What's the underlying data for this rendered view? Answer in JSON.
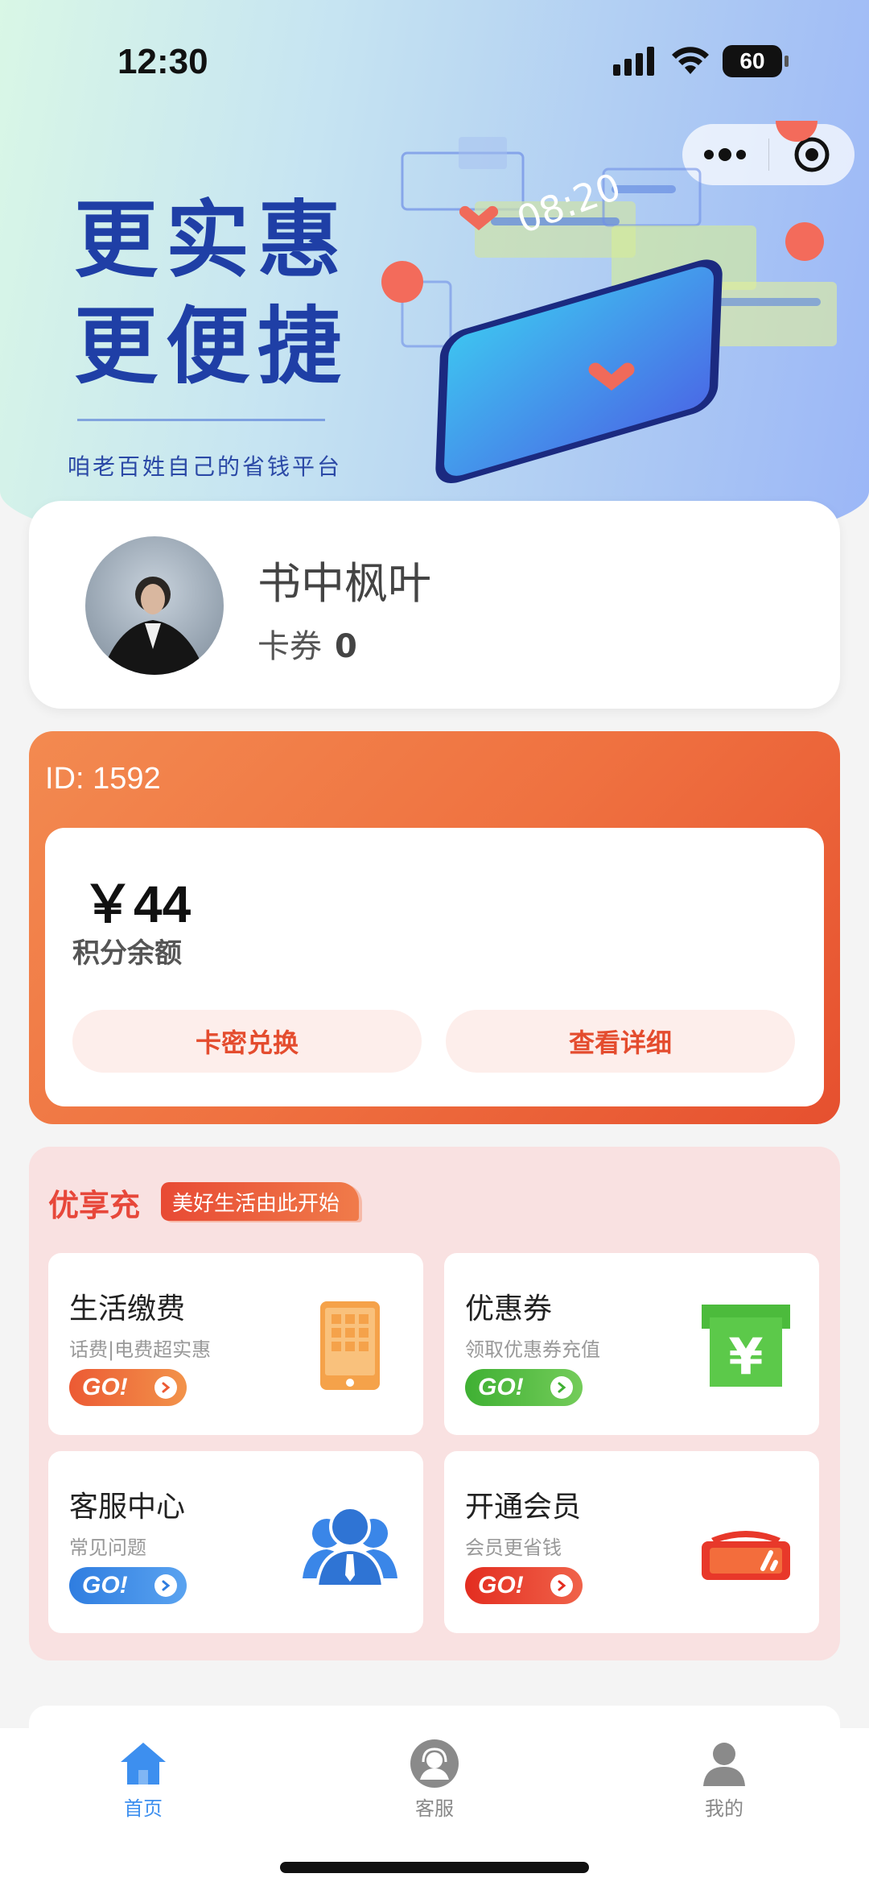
{
  "status_bar": {
    "time": "12:30",
    "battery": "60"
  },
  "banner": {
    "slogan_line1": "更实惠",
    "slogan_line2": "更便捷",
    "sub_slogan": "咱老百姓自己的省钱平台",
    "phone_time": "08:20"
  },
  "profile": {
    "nickname": "书中枫叶",
    "coupon_label": "卡券",
    "coupon_count": "0"
  },
  "points": {
    "id_label": "ID: 1592",
    "amount": "￥44",
    "amount_label": "积分余额",
    "redeem_button": "卡密兑换",
    "detail_button": "查看详细"
  },
  "enjoy": {
    "title": "优享充",
    "tag": "美好生活由此开始",
    "go_label": "GO!",
    "tiles": [
      {
        "title": "生活缴费",
        "subtitle": "话费|电费超实惠",
        "color": "#ee6a3a",
        "icon": "phone-icon"
      },
      {
        "title": "优惠券",
        "subtitle": "领取优惠券充值",
        "color": "#4cbb3c",
        "icon": "yen-voucher-icon"
      },
      {
        "title": "客服中心",
        "subtitle": "常见问题",
        "color": "#3a86e8",
        "icon": "customer-group-icon"
      },
      {
        "title": "开通会员",
        "subtitle": "会员更省钱",
        "color": "#e8382a",
        "icon": "vip-card-icon"
      }
    ]
  },
  "tabbar": {
    "items": [
      {
        "label": "首页",
        "icon": "home-icon",
        "active": true
      },
      {
        "label": "客服",
        "icon": "headset-icon",
        "active": false
      },
      {
        "label": "我的",
        "icon": "user-icon",
        "active": false
      }
    ]
  },
  "colors": {
    "accent": "#3d8fef",
    "points_gradient_start": "#f38a50",
    "points_gradient_end": "#e6502f",
    "slogan": "#1f3fa6"
  }
}
